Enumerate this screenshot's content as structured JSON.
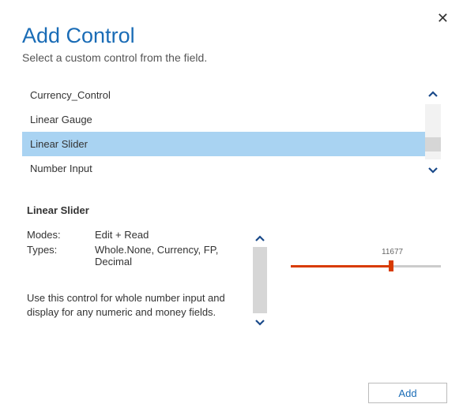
{
  "header": {
    "title": "Add Control",
    "subtitle": "Select a custom control from the field."
  },
  "control_list": {
    "items": [
      {
        "label": "Currency_Control",
        "selected": false
      },
      {
        "label": "Linear Gauge",
        "selected": false
      },
      {
        "label": "Linear Slider",
        "selected": true
      },
      {
        "label": "Number Input",
        "selected": false
      }
    ]
  },
  "detail": {
    "name": "Linear Slider",
    "modes_label": "Modes:",
    "modes_value": "Edit + Read",
    "types_label": "Types:",
    "types_value": "Whole.None, Currency, FP, Decimal",
    "description": "Use this control for whole number input and display for any numeric and money fields."
  },
  "preview": {
    "slider_value": "11677"
  },
  "footer": {
    "add_label": "Add"
  },
  "icons": {
    "chevron_up": "⌃",
    "chevron_down": "⌄"
  }
}
